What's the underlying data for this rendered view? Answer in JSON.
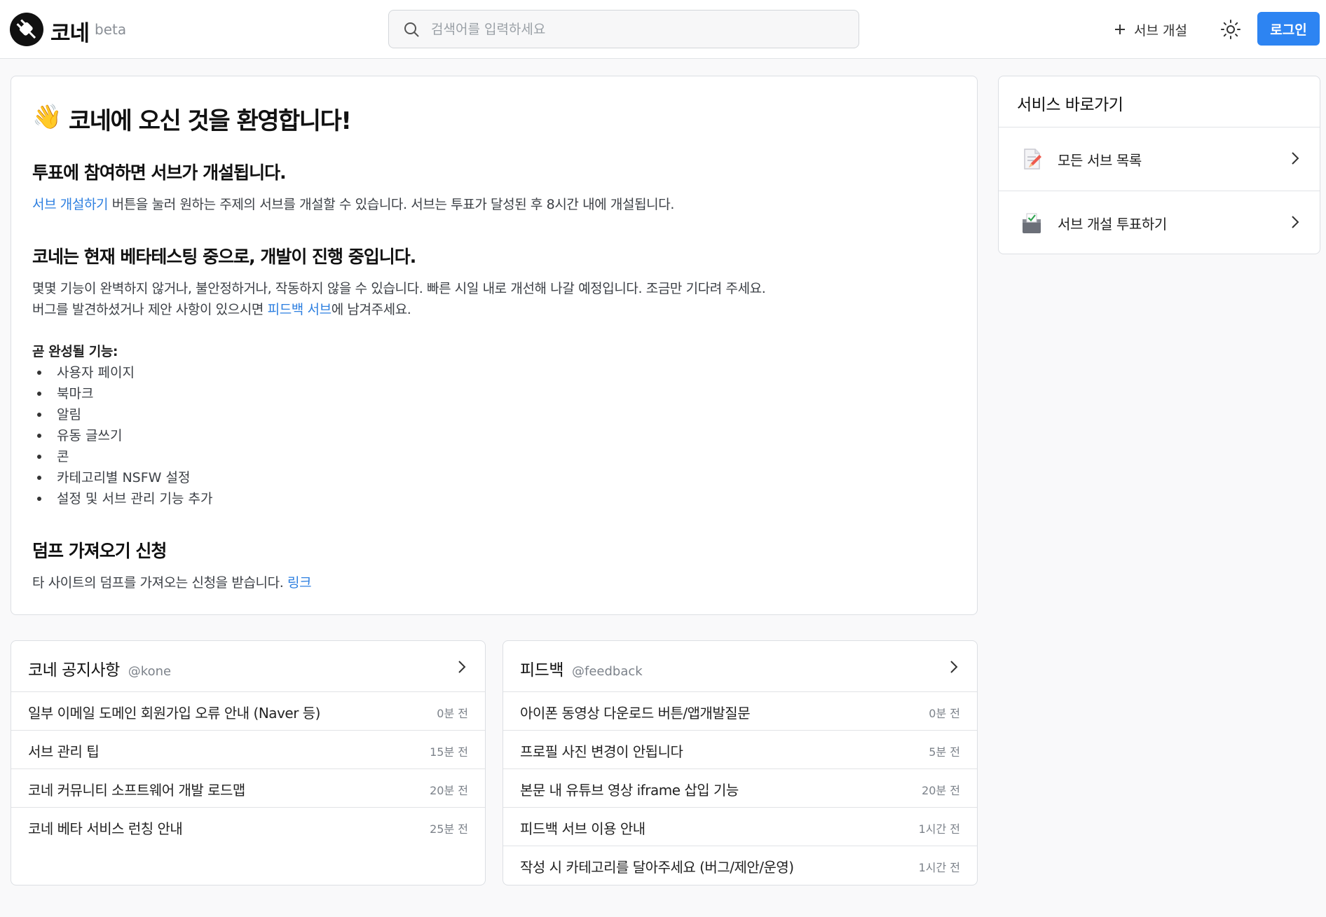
{
  "header": {
    "brand": "코네",
    "beta": "beta",
    "search_placeholder": "검색어를 입력하세요",
    "create_label": "서브 개설",
    "login_label": "로그인"
  },
  "welcome": {
    "title_emoji": "👋",
    "title": "코네에 오신 것을 환영합니다!",
    "section1_heading": "투표에 참여하면 서브가 개설됩니다.",
    "section1_link": "서브 개설하기",
    "section1_text": " 버튼을 눌러 원하는 주제의 서브를 개설할 수 있습니다. 서브는 투표가 달성된 후 8시간 내에 개설됩니다.",
    "section2_heading": "코네는 현재 베타테스팅 중으로, 개발이 진행 중입니다.",
    "section2_line1": "몇몇 기능이 완벽하지 않거나, 불안정하거나, 작동하지 않을 수 있습니다. 빠른 시일 내로 개선해 나갈 예정입니다. 조금만 기다려 주세요.",
    "section2_line2_pre": "버그를 발견하셨거나 제안 사항이 있으시면 ",
    "section2_link": "피드백 서브",
    "section2_line2_post": "에 남겨주세요.",
    "upcoming_label": "곧 완성될 기능:",
    "upcoming": [
      "사용자 페이지",
      "북마크",
      "알림",
      "유동 글쓰기",
      "콘",
      "카테고리별 NSFW 설정",
      "설정 및 서브 관리 기능 추가"
    ],
    "section3_heading": "덤프 가져오기 신청",
    "section3_text": "타 사이트의 덤프를 가져오는 신청을 받습니다. ",
    "section3_link": "링크"
  },
  "shortcuts": {
    "title": "서비스 바로가기",
    "items": [
      {
        "label": "모든 서브 목록",
        "icon": "memo-icon"
      },
      {
        "label": "서브 개설 투표하기",
        "icon": "ballot-box-icon"
      }
    ]
  },
  "boards": [
    {
      "name": "코네 공지사항",
      "handle": "@kone",
      "posts": [
        {
          "title": "일부 이메일 도메인 회원가입 오류 안내 (Naver 등)",
          "ago": "0분 전"
        },
        {
          "title": "서브 관리 팁",
          "ago": "15분 전"
        },
        {
          "title": "코네 커뮤니티 소프트웨어 개발 로드맵",
          "ago": "20분 전"
        },
        {
          "title": "코네 베타 서비스 런칭 안내",
          "ago": "25분 전"
        }
      ]
    },
    {
      "name": "피드백",
      "handle": "@feedback",
      "posts": [
        {
          "title": "아이폰 동영상 다운로드 버튼/앱개발질문",
          "ago": "0분 전"
        },
        {
          "title": "프로필 사진 변경이 안됩니다",
          "ago": "5분 전"
        },
        {
          "title": "본문 내 유튜브 영상 iframe 삽입 기능",
          "ago": "20분 전"
        },
        {
          "title": "피드백 서브 이용 안내",
          "ago": "1시간 전"
        },
        {
          "title": "작성 시 카테고리를 달아주세요 (버그/제안/운영)",
          "ago": "1시간 전"
        }
      ]
    }
  ],
  "colors": {
    "accent": "#2d84f2",
    "link": "#2d7fe0"
  }
}
